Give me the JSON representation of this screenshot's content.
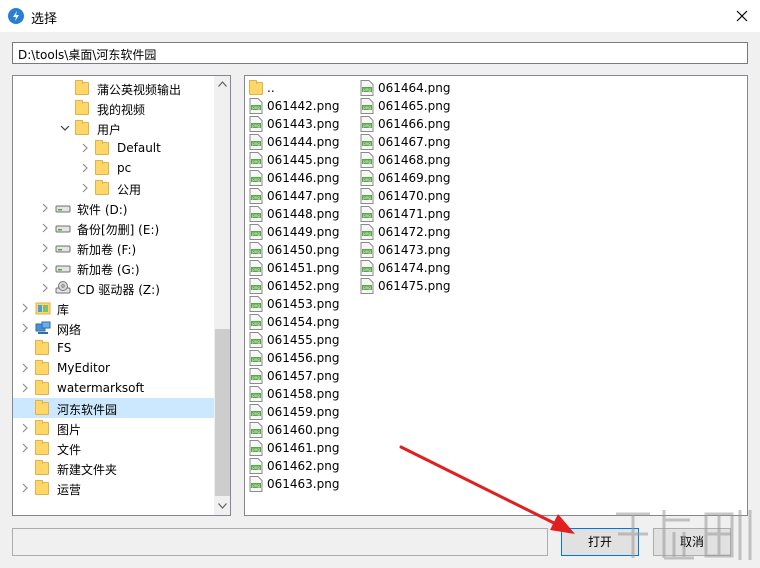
{
  "window": {
    "title": "选择",
    "app_icon": "app-icon",
    "close_icon": "close-icon"
  },
  "path_bar": {
    "value": "D:\\tools\\桌面\\河东软件园"
  },
  "tree": {
    "items": [
      {
        "label": "蒲公英视频输出",
        "icon": "folder-icon",
        "expandable": false,
        "depth": 2
      },
      {
        "label": "我的视频",
        "icon": "folder-icon",
        "expandable": false,
        "depth": 2
      },
      {
        "label": "用户",
        "icon": "folder-icon",
        "expandable": true,
        "expanded": true,
        "depth": 2
      },
      {
        "label": "Default",
        "icon": "folder-icon",
        "expandable": true,
        "depth": 3
      },
      {
        "label": "pc",
        "icon": "folder-icon",
        "expandable": true,
        "depth": 3
      },
      {
        "label": "公用",
        "icon": "folder-icon",
        "expandable": true,
        "depth": 3
      },
      {
        "label": "软件 (D:)",
        "icon": "drive-icon",
        "expandable": true,
        "depth": 1
      },
      {
        "label": "备份[勿删] (E:)",
        "icon": "drive-icon",
        "expandable": true,
        "depth": 1
      },
      {
        "label": "新加卷 (F:)",
        "icon": "drive-icon",
        "expandable": true,
        "depth": 1
      },
      {
        "label": "新加卷 (G:)",
        "icon": "drive-icon",
        "expandable": true,
        "depth": 1
      },
      {
        "label": "CD 驱动器 (Z:)",
        "icon": "cd-drive-icon",
        "expandable": true,
        "depth": 1
      },
      {
        "label": "库",
        "icon": "library-icon",
        "expandable": true,
        "depth": 0
      },
      {
        "label": "网络",
        "icon": "network-icon",
        "expandable": true,
        "depth": 0
      },
      {
        "label": "FS",
        "icon": "folder-icon",
        "expandable": false,
        "depth": 0
      },
      {
        "label": "MyEditor",
        "icon": "folder-icon",
        "expandable": true,
        "depth": 0
      },
      {
        "label": "watermarksoft",
        "icon": "folder-icon",
        "expandable": true,
        "depth": 0
      },
      {
        "label": "河东软件园",
        "icon": "folder-icon",
        "expandable": false,
        "depth": 0,
        "selected": true
      },
      {
        "label": "图片",
        "icon": "folder-icon",
        "expandable": true,
        "depth": 0
      },
      {
        "label": "文件",
        "icon": "folder-icon",
        "expandable": true,
        "depth": 0
      },
      {
        "label": "新建文件夹",
        "icon": "folder-icon",
        "expandable": false,
        "depth": 0
      },
      {
        "label": "运营",
        "icon": "folder-icon",
        "expandable": true,
        "depth": 0
      }
    ]
  },
  "files": {
    "updir_label": "..",
    "items": [
      "061442.png",
      "061443.png",
      "061444.png",
      "061445.png",
      "061446.png",
      "061447.png",
      "061448.png",
      "061449.png",
      "061450.png",
      "061451.png",
      "061452.png",
      "061453.png",
      "061454.png",
      "061455.png",
      "061456.png",
      "061457.png",
      "061458.png",
      "061459.png",
      "061460.png",
      "061461.png",
      "061462.png",
      "061463.png",
      "061464.png",
      "061465.png",
      "061466.png",
      "061467.png",
      "061468.png",
      "061469.png",
      "061470.png",
      "061471.png",
      "061472.png",
      "061473.png",
      "061474.png",
      "061475.png"
    ],
    "icon": "png-file-icon"
  },
  "status_field": {
    "value": ""
  },
  "buttons": {
    "open": "打开",
    "cancel": "取消"
  },
  "colors": {
    "selection": "#cce8ff",
    "folder": "#ffd768",
    "accent": "#0078d7",
    "annotation_arrow": "#e02020"
  }
}
